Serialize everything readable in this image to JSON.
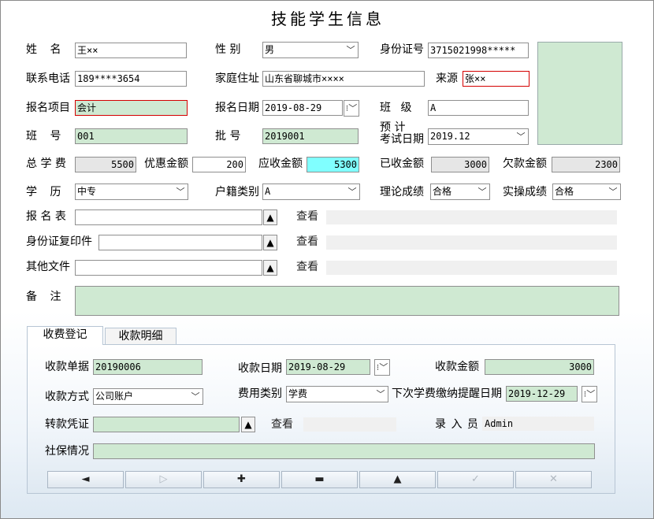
{
  "title": "技能学生信息",
  "labels": {
    "name": "姓    名",
    "gender": "性  别",
    "id_no": "身份证号",
    "phone": "联系电话",
    "address": "家庭住址",
    "source": "来源",
    "project": "报名项目",
    "enroll_date": "报名日期",
    "class": "班  级",
    "class_no": "班    号",
    "batch": "批  号",
    "exam_date_top": "预    计",
    "exam_date_bottom": "考试日期",
    "total_fee": "总 学 费",
    "discount": "优惠金额",
    "receivable": "应收金额",
    "received": "已收金额",
    "owed": "欠款金额",
    "education": "学    历",
    "household": "户籍类别",
    "theory": "理论成绩",
    "practice": "实操成绩",
    "form": "报 名 表",
    "id_copy": "身份证复印件",
    "other_files": "其他文件",
    "view": "查看",
    "remark": "备    注"
  },
  "fields": {
    "name": "王××",
    "gender": "男",
    "id_no": "3715021998*****",
    "phone": "189****3654",
    "address": "山东省聊城市××××",
    "source": "张××",
    "project": "会计",
    "enroll_date": "2019-08-29",
    "class": "A",
    "class_no": "001",
    "batch": "2019001",
    "exam_date": "2019.12",
    "total_fee": "5500",
    "discount": "200",
    "receivable": "5300",
    "received": "3000",
    "owed": "2300",
    "education": "中专",
    "household": "A",
    "theory": "合格",
    "practice": "合格"
  },
  "tabs": [
    "收费登记",
    "收款明细"
  ],
  "payment": {
    "labels": {
      "receipt": "收款单据",
      "pay_date": "收款日期",
      "amount": "收款金额",
      "method": "收款方式",
      "fee_type": "费用类别",
      "next_remind": "下次学费缴纳提醒日期",
      "voucher": "转款凭证",
      "view": "查看",
      "operator": "录 入 员",
      "social": "社保情况"
    },
    "receipt": "20190006",
    "pay_date": "2019-08-29",
    "amount": "3000",
    "method": "公司账户",
    "fee_type": "学费",
    "next_remind": "2019-12-29",
    "operator": "Admin"
  },
  "nav": [
    "◄",
    "▷",
    "✚",
    "▬",
    "▲",
    "✓",
    "✕"
  ]
}
